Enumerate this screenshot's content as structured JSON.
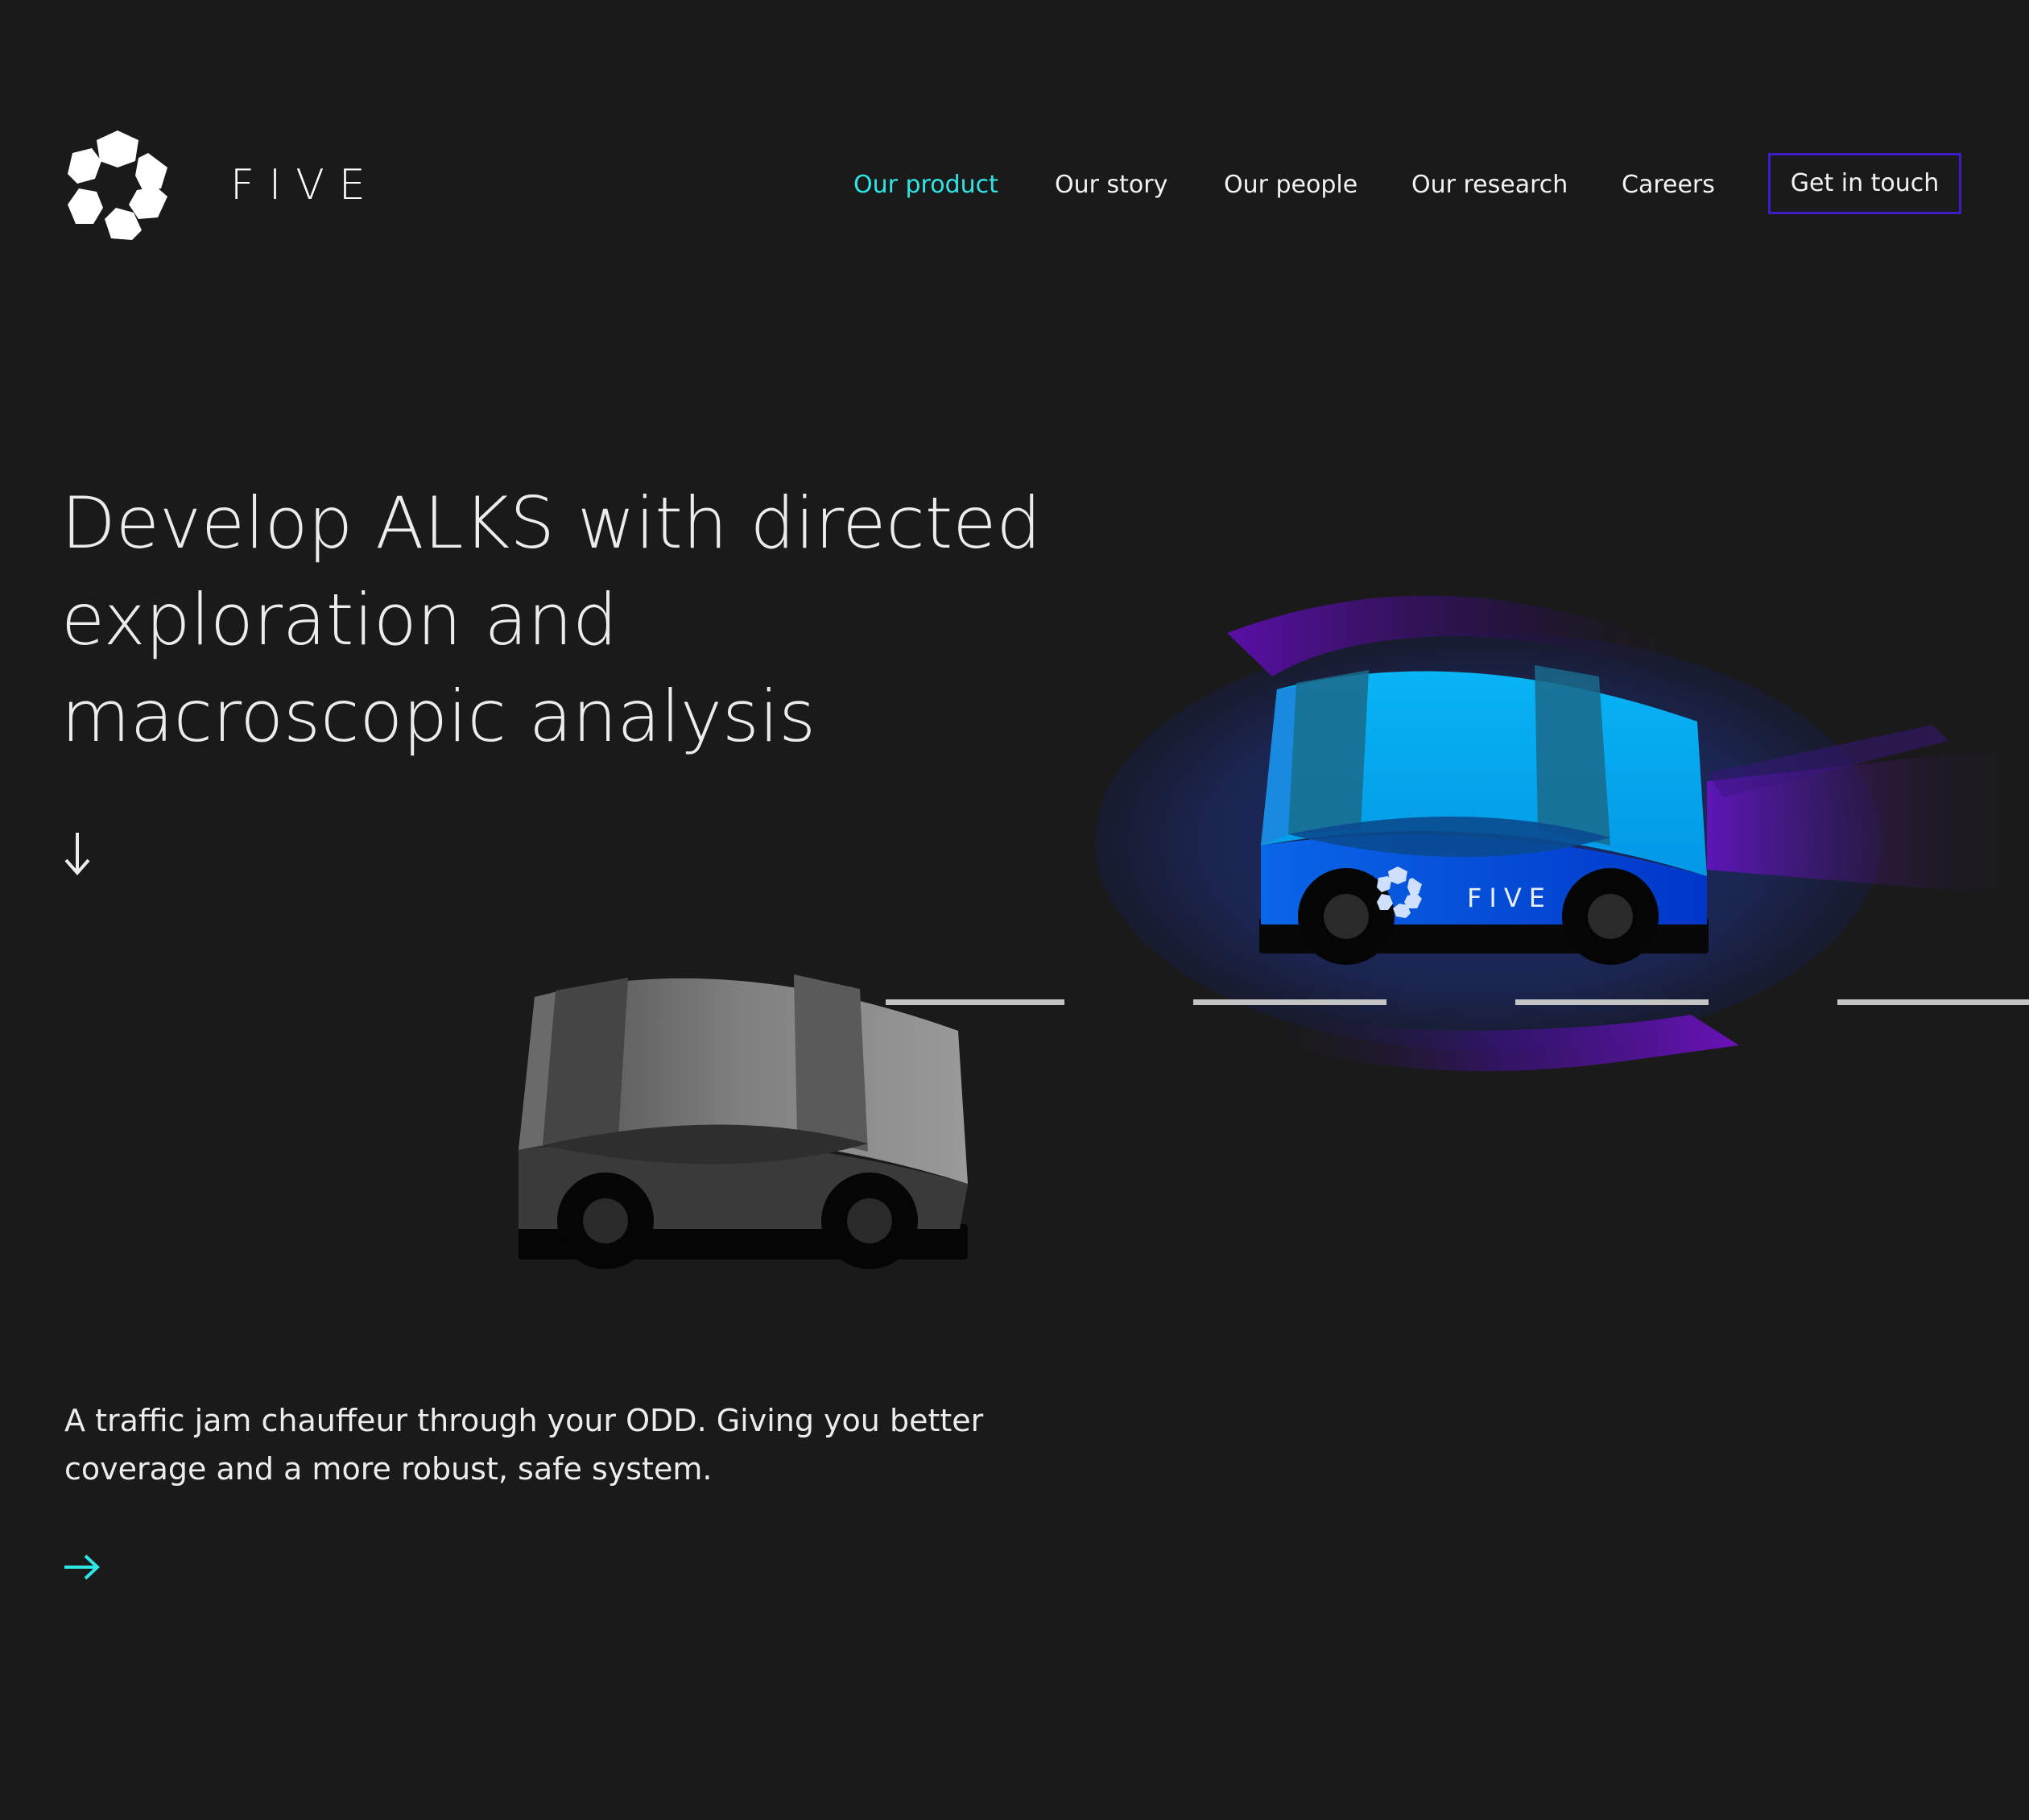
{
  "brand": {
    "name": "FIVE",
    "logo_icon": "five-star-logo-icon",
    "accent_color": "#2ee6e6",
    "cta_border_color": "#3d1cc4",
    "background_color": "#1a1a1a"
  },
  "nav": {
    "items": [
      {
        "label": "Our product",
        "active": true
      },
      {
        "label": "Our story",
        "active": false
      },
      {
        "label": "Our people",
        "active": false
      },
      {
        "label": "Our research",
        "active": false
      },
      {
        "label": "Careers",
        "active": false
      }
    ],
    "cta_label": "Get in touch"
  },
  "hero": {
    "headline_lines": [
      "Develop ALKS with directed",
      "exploration and",
      "macroscopic analysis"
    ],
    "scroll_icon": "arrow-down-icon",
    "car_badge": "FIVE"
  },
  "intro": {
    "tagline_lines": [
      "A traffic jam chauffeur through your ODD. Giving you better",
      "coverage and a more robust, safe system."
    ],
    "cta_icon": "arrow-right-icon"
  }
}
